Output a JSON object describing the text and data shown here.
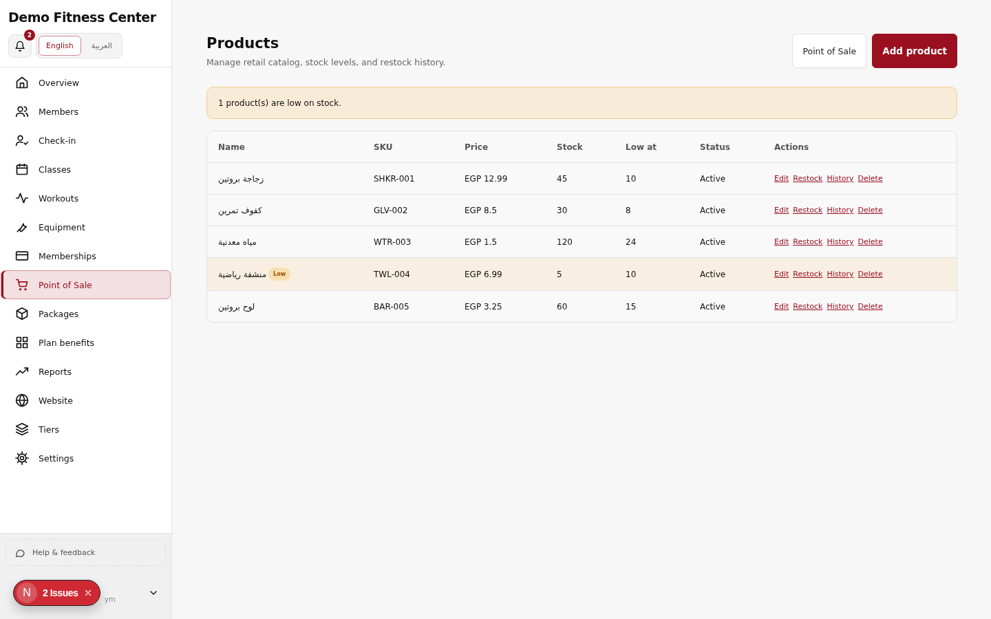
{
  "sidebar": {
    "brand": "Demo Fitness Center",
    "notifications": {
      "count": "2"
    },
    "languages": [
      {
        "label": "English",
        "selected": true
      },
      {
        "label": "العربية",
        "selected": false
      }
    ],
    "items": [
      {
        "label": "Overview",
        "selected": false
      },
      {
        "label": "Members",
        "selected": false
      },
      {
        "label": "Check-in",
        "selected": false
      },
      {
        "label": "Classes",
        "selected": false
      },
      {
        "label": "Workouts",
        "selected": false
      },
      {
        "label": "Equipment",
        "selected": false
      },
      {
        "label": "Memberships",
        "selected": false
      },
      {
        "label": "Point of Sale",
        "selected": true
      },
      {
        "label": "Packages",
        "selected": false
      },
      {
        "label": "Plan benefits",
        "selected": false
      },
      {
        "label": "Reports",
        "selected": false
      },
      {
        "label": "Website",
        "selected": false
      },
      {
        "label": "Tiers",
        "selected": false
      },
      {
        "label": "Settings",
        "selected": false
      }
    ],
    "help": "Help & feedback",
    "user_fragment": "ym"
  },
  "issues_badge": {
    "letter": "N",
    "label": "2 Issues"
  },
  "page": {
    "title": "Products",
    "subtitle": "Manage retail catalog, stock levels, and restock history.",
    "buttons": [
      "Point of Sale",
      "Add product"
    ],
    "alert": "1 product(s) are low on stock."
  },
  "table": {
    "columns": [
      "Name",
      "SKU",
      "Price",
      "Stock",
      "Low at",
      "Status",
      "Actions"
    ],
    "rows": [
      {
        "name": "زجاجة بروتين",
        "sku": "SHKR-001",
        "price": "EGP 12.99",
        "stock": "45",
        "low_at": "10",
        "status": "Active",
        "low_stock": false,
        "actions": [
          "Edit",
          "Restock",
          "History",
          "Delete"
        ]
      },
      {
        "name": "كفوف تمرين",
        "sku": "GLV-002",
        "price": "EGP 8.5",
        "stock": "30",
        "low_at": "8",
        "status": "Active",
        "low_stock": false,
        "actions": [
          "Edit",
          "Restock",
          "History",
          "Delete"
        ]
      },
      {
        "name": "مياه معدنية",
        "sku": "WTR-003",
        "price": "EGP 1.5",
        "stock": "120",
        "low_at": "24",
        "status": "Active",
        "low_stock": false,
        "actions": [
          "Edit",
          "Restock",
          "History",
          "Delete"
        ]
      },
      {
        "name": "منشفة رياضية",
        "sku": "TWL-004",
        "price": "EGP 6.99",
        "stock": "5",
        "low_at": "10",
        "status": "Active",
        "low_stock": true,
        "badge": "Low",
        "actions": [
          "Edit",
          "Restock",
          "History",
          "Delete"
        ]
      },
      {
        "name": "لوح بروتين",
        "sku": "BAR-005",
        "price": "EGP 3.25",
        "stock": "60",
        "low_at": "15",
        "status": "Active",
        "low_stock": false,
        "actions": [
          "Edit",
          "Restock",
          "History",
          "Delete"
        ]
      }
    ]
  }
}
